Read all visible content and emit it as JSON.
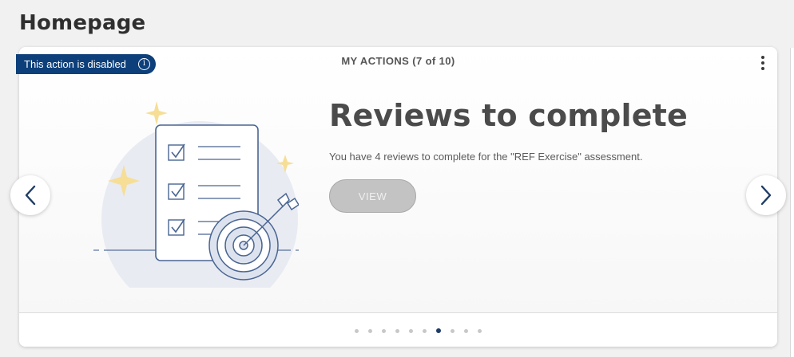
{
  "page": {
    "title": "Homepage"
  },
  "badge": {
    "label": "This action is disabled",
    "icon": "info-icon",
    "icon_glyph": "i"
  },
  "card": {
    "header_title": "MY ACTIONS (7 of 10)",
    "menu_icon": "kebab-menu-icon",
    "headline": "Reviews to complete",
    "description": "You have 4 reviews to complete for the \"REF Exercise\" assessment.",
    "view_label": "VIEW"
  },
  "carousel": {
    "total": 10,
    "active_index": 6,
    "prev_icon": "chevron-left-icon",
    "next_icon": "chevron-right-icon"
  },
  "colors": {
    "badge_bg": "#0d3f7a",
    "nav_chevron": "#1f3c66",
    "active_dot": "#1f3c66",
    "disabled_button": "#c3c3c3"
  }
}
